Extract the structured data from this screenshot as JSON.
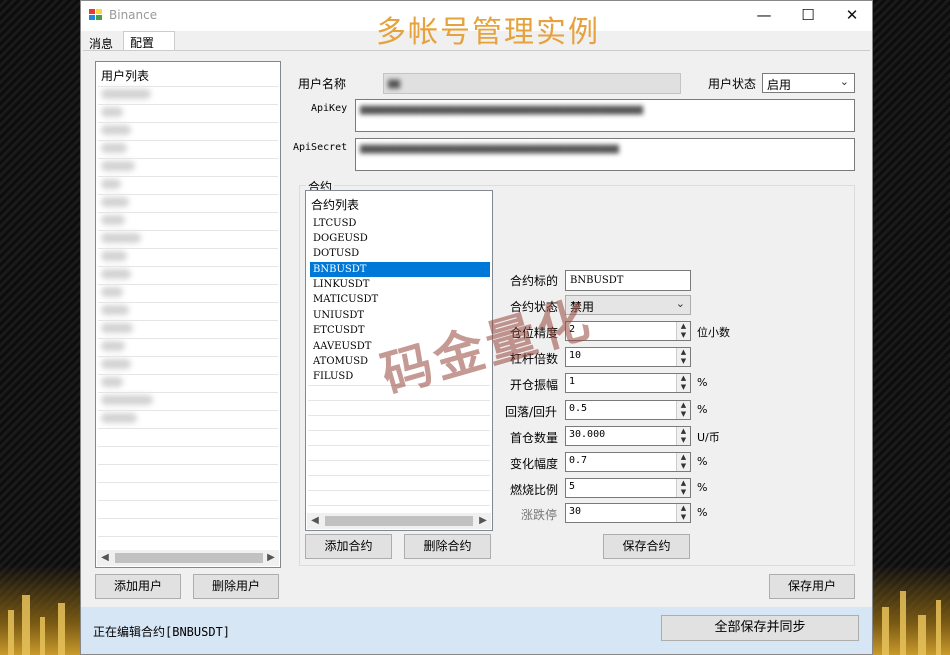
{
  "window": {
    "app_title": "Binance",
    "big_title": "多帐号管理实例",
    "controls": {
      "minimize": "—",
      "maximize": "☐",
      "close": "✕"
    }
  },
  "tabs": [
    {
      "label": "消息",
      "active": false
    },
    {
      "label": "配置",
      "active": true
    }
  ],
  "user_list": {
    "header": "用户列表",
    "add_button": "添加用户",
    "delete_button": "删除用户"
  },
  "user_form": {
    "name_label": "用户名称",
    "status_label": "用户状态",
    "status_value": "启用",
    "apikey_label": "ApiKey",
    "apisecret_label": "ApiSecret",
    "save_button": "保存用户"
  },
  "contract_group": {
    "label": "合约",
    "list_header": "合约列表",
    "items": [
      "LTCUSD",
      "DOGEUSD",
      "DOTUSD",
      "BNBUSDT",
      "LINKUSDT",
      "MATICUSDT",
      "UNIUSDT",
      "ETCUSDT",
      "AAVEUSDT",
      "ATOMUSD",
      "FILUSD"
    ],
    "selected": "BNBUSDT",
    "add_button": "添加合约",
    "delete_button": "删除合约",
    "save_button": "保存合约"
  },
  "contract_form": {
    "symbol_label": "合约标的",
    "symbol_value": "BNBUSDT",
    "state_label": "合约状态",
    "state_value": "禁用",
    "fields": [
      {
        "label": "仓位精度",
        "value": "2",
        "unit": "位小数"
      },
      {
        "label": "杠杆倍数",
        "value": "10",
        "unit": ""
      },
      {
        "label": "开仓振幅",
        "value": "1",
        "unit": "%"
      },
      {
        "label": "回落/回升",
        "value": "0.5",
        "unit": "%"
      },
      {
        "label": "首仓数量",
        "value": "30.000",
        "unit": "U/币"
      },
      {
        "label": "变化幅度",
        "value": "0.7",
        "unit": "%"
      },
      {
        "label": "燃烧比例",
        "value": "5",
        "unit": "%"
      },
      {
        "label": "涨跌停",
        "value": "30",
        "unit": "%"
      }
    ]
  },
  "statusbar": {
    "message": "正在编辑合约[BNBUSDT]",
    "save_all_button": "全部保存并同步"
  },
  "watermark": "码金量化",
  "colors": {
    "accent": "#0078d7",
    "title": "#e6a23c",
    "statusbar": "#d7e6f4"
  }
}
